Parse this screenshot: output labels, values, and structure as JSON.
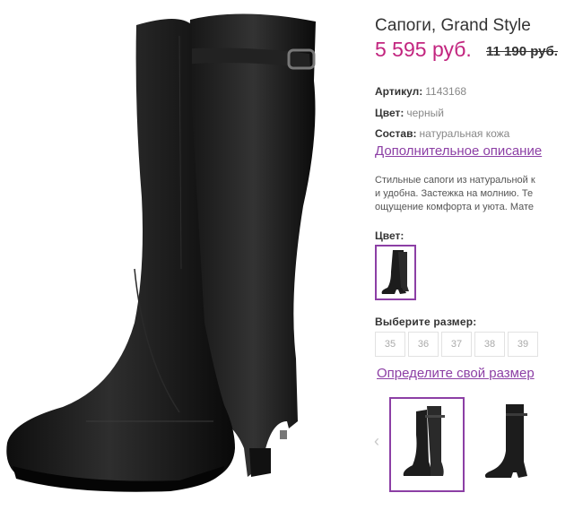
{
  "product": {
    "title": "Сапоги, Grand Style",
    "price": "5 595 руб.",
    "old_price": "11 190 руб."
  },
  "attributes": {
    "sku_label": "Артикул:",
    "sku_value": "1143168",
    "color_label": "Цвет:",
    "color_value": "черный",
    "material_label": "Состав:",
    "material_value": "натуральная кожа"
  },
  "more_description_link": "Дополнительное описание",
  "description": {
    "line1": "Стильные сапоги из натуральной к",
    "line2": "и удобна. Застежка на молнию. Те",
    "line3": "ощущение комфорта и уюта. Мате"
  },
  "color_picker": {
    "label": "Цвет:"
  },
  "size_picker": {
    "label": "Выберите размер:",
    "sizes": [
      "35",
      "36",
      "37",
      "38",
      "39"
    ]
  },
  "size_guide_link": "Определите свой размер",
  "gallery": {
    "prev_icon": "chevron-left-icon"
  },
  "colors": {
    "accent": "#8c3fa5",
    "price": "#c2257f",
    "boot": "#1b1b1b"
  }
}
